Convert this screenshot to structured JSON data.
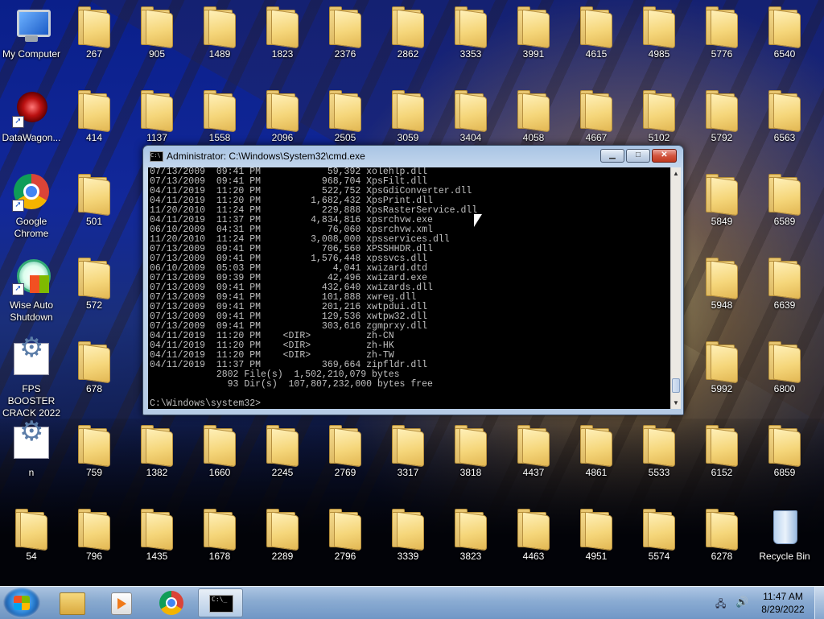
{
  "desktop": {
    "special_icons": {
      "my_computer": "My Computer",
      "datawagon": "DataWagon...",
      "chrome": "Google Chrome",
      "wise_auto_shutdown": "Wise Auto Shutdown",
      "fps_booster": "FPS BOOSTER CRACK 2022",
      "n": "n",
      "recycle_bin": "Recycle Bin"
    },
    "folders": {
      "r0": [
        "267",
        "905",
        "1489",
        "1823",
        "2376",
        "2862",
        "3353",
        "3991",
        "4615",
        "4985",
        "5776",
        "6540"
      ],
      "r1": [
        "414",
        "1137",
        "1558",
        "2096",
        "2505",
        "3059",
        "3404",
        "4058",
        "4667",
        "5102",
        "5792",
        "6563"
      ],
      "r2": [
        "501",
        "5849",
        "6589"
      ],
      "r3": [
        "572",
        "5948",
        "6639"
      ],
      "r4": [
        "678",
        "5992",
        "6800"
      ],
      "r5": [
        "759",
        "1382",
        "1660",
        "2245",
        "2769",
        "3317",
        "3818",
        "4437",
        "4861",
        "5533",
        "6152",
        "6859"
      ],
      "r6": [
        "54",
        "796",
        "1435",
        "1678",
        "2289",
        "2796",
        "3339",
        "3823",
        "4463",
        "4951",
        "5574",
        "6278"
      ]
    }
  },
  "cmd": {
    "title": "Administrator: C:\\Windows\\System32\\cmd.exe",
    "minimize_glyph": "▁",
    "maximize_glyph": "□",
    "close_glyph": "✕",
    "console_text": "07/13/2009  09:41 PM            59,392 xolehlp.dll\n07/13/2009  09:41 PM           968,704 XpsFilt.dll\n04/11/2019  11:20 PM           522,752 XpsGdiConverter.dll\n04/11/2019  11:20 PM         1,682,432 XpsPrint.dll\n11/20/2010  11:24 PM           229,888 XpsRasterService.dll\n04/11/2019  11:37 PM         4,834,816 xpsrchvw.exe\n06/10/2009  04:31 PM            76,060 xpsrchvw.xml\n11/20/2010  11:24 PM         3,008,000 xpsservices.dll\n07/13/2009  09:41 PM           706,560 XPSSHHDR.dll\n07/13/2009  09:41 PM         1,576,448 xpssvcs.dll\n06/10/2009  05:03 PM             4,041 xwizard.dtd\n07/13/2009  09:39 PM            42,496 xwizard.exe\n07/13/2009  09:41 PM           432,640 xwizards.dll\n07/13/2009  09:41 PM           101,888 xwreg.dll\n07/13/2009  09:41 PM           201,216 xwtpdui.dll\n07/13/2009  09:41 PM           129,536 xwtpw32.dll\n07/13/2009  09:41 PM           303,616 zgmprxy.dll\n04/11/2019  11:20 PM    <DIR>          zh-CN\n04/11/2019  11:20 PM    <DIR>          zh-HK\n04/11/2019  11:20 PM    <DIR>          zh-TW\n04/11/2019  11:37 PM           369,664 zipfldr.dll\n            2802 File(s)  1,502,210,079 bytes\n              93 Dir(s)  107,807,232,000 bytes free\n\nC:\\Windows\\system32>"
  },
  "taskbar": {
    "clock_time": "11:47 AM",
    "clock_date": "8/29/2022",
    "cmd_icon_text": "C:\\_"
  },
  "colors": {
    "console_bg": "#000000",
    "console_fg": "#c0c0c0",
    "folder": "#f5d67a"
  },
  "icons": {
    "folder": "folder-icon",
    "computer": "computer-icon",
    "chrome": "chrome-icon",
    "recycle": "recycle-bin-icon",
    "start": "windows-start-icon"
  }
}
